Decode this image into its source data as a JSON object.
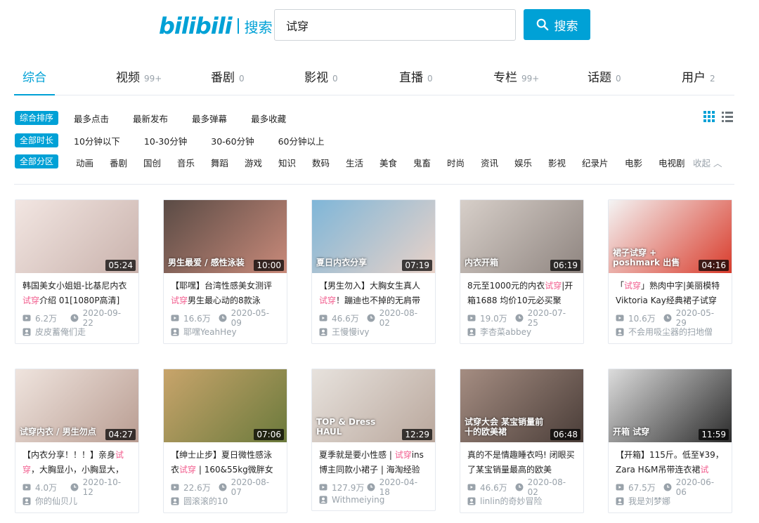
{
  "header": {
    "logo_text": "bilibili",
    "logo_sub": "搜索",
    "search_value": "试穿",
    "search_button": "搜索"
  },
  "tabs": [
    {
      "label": "综合",
      "count": ""
    },
    {
      "label": "视频",
      "count": "99+"
    },
    {
      "label": "番剧",
      "count": "0"
    },
    {
      "label": "影视",
      "count": "0"
    },
    {
      "label": "直播",
      "count": "0"
    },
    {
      "label": "专栏",
      "count": "99+"
    },
    {
      "label": "话题",
      "count": "0"
    },
    {
      "label": "用户",
      "count": "2"
    }
  ],
  "filters": {
    "sort": {
      "tag": "综合排序",
      "options": [
        "最多点击",
        "最新发布",
        "最多弹幕",
        "最多收藏"
      ]
    },
    "duration": {
      "tag": "全部时长",
      "options": [
        "10分钟以下",
        "10-30分钟",
        "30-60分钟",
        "60分钟以上"
      ]
    },
    "zone": {
      "tag": "全部分区",
      "options": [
        "动画",
        "番剧",
        "国创",
        "音乐",
        "舞蹈",
        "游戏",
        "知识",
        "数码",
        "生活",
        "美食",
        "鬼畜",
        "时尚",
        "资讯",
        "娱乐",
        "影视",
        "纪录片",
        "电影",
        "电视剧"
      ],
      "collapse": "收起"
    }
  },
  "videos": [
    {
      "title_a": "韩国美女小姐姐-比基尼内衣",
      "hl": "试穿",
      "title_b": "介绍 01[1080P高清]",
      "lead": "",
      "duration": "05:24",
      "views": "6.2万",
      "date": "2020-09-22",
      "uploader": "皮皮蓄俺们走",
      "thumb_colors": [
        "#f2e6e2",
        "#c9b2ac"
      ],
      "overlay": ""
    },
    {
      "title_a": "【耶嘿】台湾性感美女测评",
      "hl": "试穿",
      "title_b": "男生最心动的8款泳",
      "lead": "",
      "duration": "10:00",
      "views": "16.6万",
      "date": "2020-05-09",
      "uploader": "耶嘿YeahHey",
      "thumb_colors": [
        "#5a4b45",
        "#c98a7a"
      ],
      "overlay": "男生最爱 / 感性泳装"
    },
    {
      "title_a": "【男生勿入】大胸女生真人",
      "hl": "试穿",
      "title_b": "！蹦迪也不掉的无肩带",
      "lead": "",
      "duration": "07:19",
      "views": "46.6万",
      "date": "2020-08-02",
      "uploader": "王慢慢ivy",
      "thumb_colors": [
        "#7fb6d8",
        "#e9d2c8"
      ],
      "overlay": "夏日内衣分享"
    },
    {
      "title_a": "8元至1000元的内衣",
      "hl": "试穿",
      "title_b": "|开箱1688 均价10元必买聚",
      "lead": "",
      "duration": "06:19",
      "views": "19.0万",
      "date": "2020-07-25",
      "uploader": "李杏菜abbey",
      "thumb_colors": [
        "#d7cfc9",
        "#8f8580"
      ],
      "overlay": "内衣开箱"
    },
    {
      "title_a": "「",
      "hl": "试穿",
      "title_b": "」熟肉中字|美丽模特 Viktoria Kay经典裙子试穿秀",
      "lead": "",
      "duration": "04:16",
      "views": "10.6万",
      "date": "2020-05-29",
      "uploader": "不会用吸尘器的扫地僧",
      "thumb_colors": [
        "#f4f4f4",
        "#d93c2c"
      ],
      "overlay": "裙子试穿 + poshmark 出售"
    },
    {
      "title_a": "【内衣分享！！！】亲身",
      "hl": "试穿",
      "title_b": "，大胸显小，小胸显大，",
      "lead": "",
      "duration": "04:27",
      "views": "4.0万",
      "date": "2020-10-12",
      "uploader": "你的仙贝儿",
      "thumb_colors": [
        "#efe4de",
        "#b99d92"
      ],
      "overlay": "试穿内衣 / 男生勿点"
    },
    {
      "title_a": "【绅士止步】夏日微性感泳衣",
      "hl": "试穿",
      "title_b": " | 160&55kg微胖女孩",
      "lead": "",
      "duration": "07:06",
      "views": "22.6万",
      "date": "2020-08-07",
      "uploader": "圆滚滚的10",
      "thumb_colors": [
        "#c8a46b",
        "#6b7a3c"
      ],
      "overlay": ""
    },
    {
      "title_a": "夏季就是要小性感 | ",
      "hl": "试穿",
      "title_b": "ins博主同款小裙子 | 海淘经验",
      "lead": "",
      "duration": "12:29",
      "views": "127.9万",
      "date": "2020-04-18",
      "uploader": "Withmeiying",
      "thumb_colors": [
        "#e7e2dd",
        "#b9a79c"
      ],
      "overlay": "TOP & Dress HAUL"
    },
    {
      "title_a": "真的不是情趣睡衣吗! 闭眼买了某宝销量最高的欧美",
      "hl": "",
      "title_b": "",
      "lead": "",
      "duration": "06:48",
      "views": "46.6万",
      "date": "2020-08-02",
      "uploader": "linlin的奇妙冒险",
      "thumb_colors": [
        "#a58d82",
        "#4a3d38"
      ],
      "overlay": "试穿大会 某宝销量前十的欧美裙"
    },
    {
      "title_a": "【开箱】115斤。低至¥39，Zara H&M吊带连衣裙",
      "hl": "试",
      "title_b": "",
      "lead": "",
      "duration": "11:59",
      "views": "67.5万",
      "date": "2020-06-06",
      "uploader": "我是刘梦娜",
      "thumb_colors": [
        "#dcdcdc",
        "#2b2b2b"
      ],
      "overlay": "开箱 试穿"
    }
  ]
}
